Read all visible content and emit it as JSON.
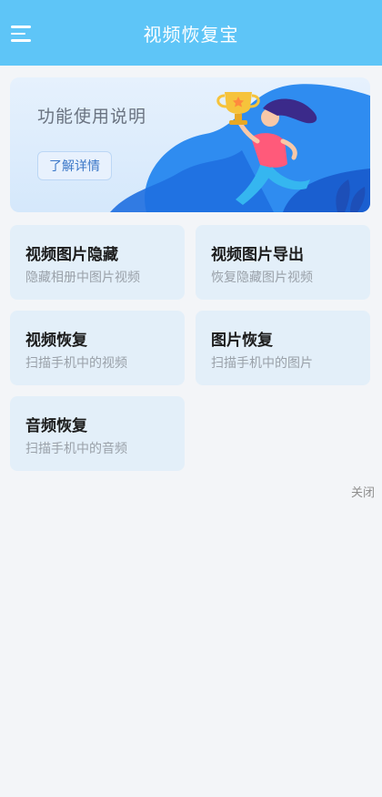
{
  "header": {
    "title": "视频恢复宝",
    "menu_icon": "hamburger-menu-icon"
  },
  "banner": {
    "title": "功能使用说明",
    "button_label": "了解详情",
    "illustration": "trophy-runner-illustration"
  },
  "cards": [
    {
      "title": "视频图片隐藏",
      "subtitle": "隐藏相册中图片视频"
    },
    {
      "title": "视频图片导出",
      "subtitle": "恢复隐藏图片视频"
    },
    {
      "title": "视频恢复",
      "subtitle": "扫描手机中的视频"
    },
    {
      "title": "图片恢复",
      "subtitle": "扫描手机中的图片"
    },
    {
      "title": "音频恢复",
      "subtitle": "扫描手机中的音频"
    }
  ],
  "close_label": "关闭",
  "colors": {
    "header": "#5ec5f7",
    "card_bg": "#e3eff9",
    "page_bg": "#f3f5f8"
  }
}
